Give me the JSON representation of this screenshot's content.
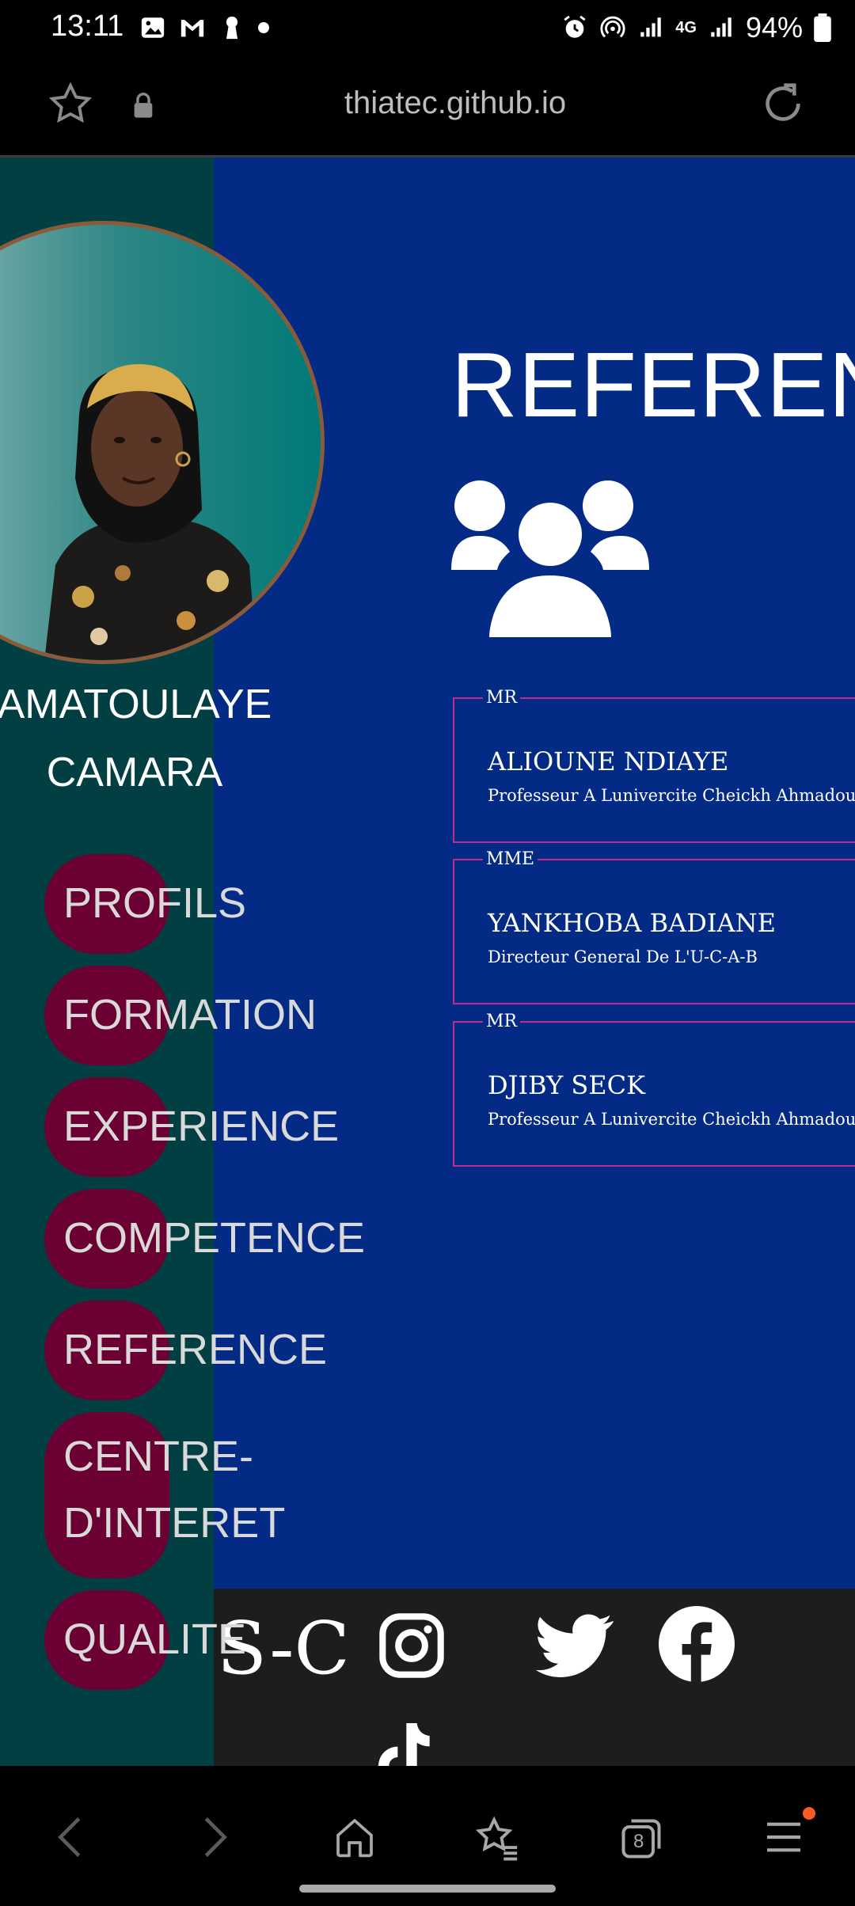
{
  "status_bar": {
    "time": "13:11",
    "battery": "94%",
    "network": "4G"
  },
  "browser": {
    "url": "thiatec.github.io"
  },
  "profile": {
    "name_line1": "AMATOULAYE",
    "name_line2": "CAMARA"
  },
  "nav": {
    "items": [
      {
        "label": "PROFILS"
      },
      {
        "label": "FORMATION"
      },
      {
        "label": "EXPERIENCE"
      },
      {
        "label": "COMPETENCE"
      },
      {
        "label": "REFERENCE"
      },
      {
        "label": "CENTRE-D'INTERET"
      },
      {
        "label": "QUALITE"
      }
    ]
  },
  "main": {
    "title": "REFERENCE",
    "references": [
      {
        "title": "MR",
        "name": "ALIOUNE NDIAYE",
        "role": "Professeur A Lunivercite Cheickh Ahmadou Bamba"
      },
      {
        "title": "MME",
        "name": "YANKHOBA BADIANE",
        "role": "Directeur General De L'U-C-A-B"
      },
      {
        "title": "MR",
        "name": "DJIBY SECK",
        "role": "Professeur A Lunivercite Cheickh Ahmadou Bamba"
      }
    ]
  },
  "footer": {
    "brand": "S-C"
  },
  "bottom_nav": {
    "tabs_count": "8"
  },
  "colors": {
    "page_bg": "#032b86",
    "sidebar_bg": "#023f43",
    "pill": "#6b0033",
    "card_border": "#c2288e",
    "footer_bg": "#1d1d1d",
    "notification_dot": "#ff5a1f"
  }
}
